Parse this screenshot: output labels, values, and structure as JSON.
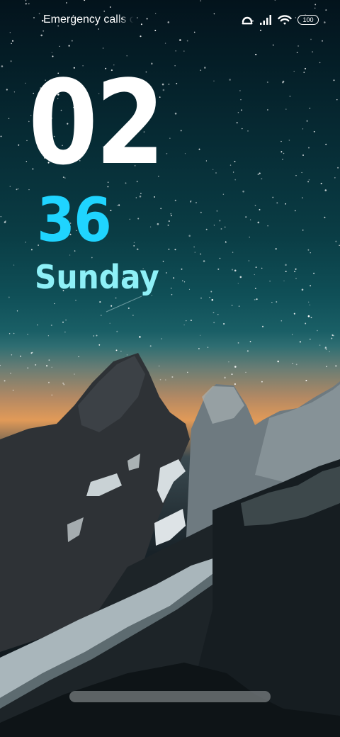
{
  "status_bar": {
    "carrier_text": "Emergency calls o",
    "battery_level": "100",
    "icons": [
      "data-saver-icon",
      "signal-icon",
      "wifi-icon",
      "battery-icon"
    ]
  },
  "lock_screen": {
    "hour": "02",
    "minute": "36",
    "weekday": "Sunday"
  },
  "colors": {
    "hour": "#ffffff",
    "minute": "#1fd4ff",
    "weekday": "#8ef0f7",
    "sky_top": "#03131c",
    "horizon_glow": "#e19a58"
  },
  "wallpaper": {
    "icon": "starry-mountain-wallpaper"
  }
}
